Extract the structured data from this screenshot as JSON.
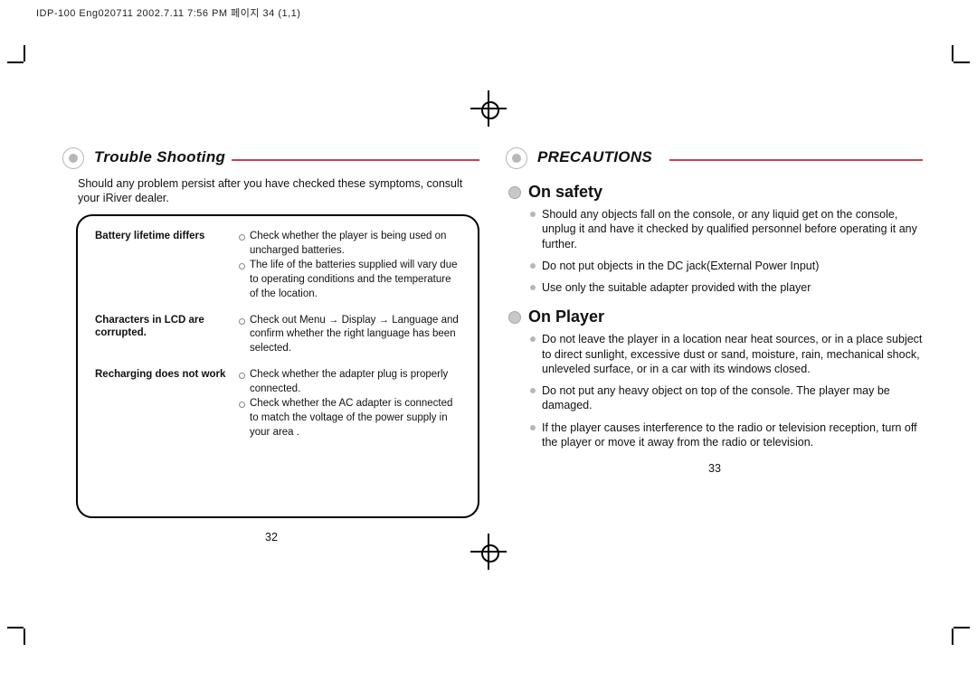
{
  "topstrip": "IDP-100 Eng020711  2002.7.11 7:56 PM  페이지 34 (1,1)",
  "left": {
    "title": "Trouble Shooting",
    "intro": "Should any problem persist after you have checked these symptoms, consult your iRiver dealer.",
    "rows": [
      {
        "label": "Battery lifetime differs",
        "items": [
          "Check whether the player is being used on uncharged batteries.",
          "The life of the batteries supplied will vary due to operating conditions and the temperature of the location."
        ]
      },
      {
        "label": "Characters in LCD are corrupted.",
        "items": [
          "Check out Menu → Display → Language and confirm whether the right language has been selected."
        ]
      },
      {
        "label": "Recharging does not work",
        "items": [
          "Check whether the adapter plug is properly connected.",
          "Check whether the AC adapter is connected to match the voltage of the power supply in your area ."
        ]
      }
    ],
    "pagenum": "32"
  },
  "right": {
    "title": "PRECAUTIONS",
    "sections": [
      {
        "heading": "On safety",
        "items": [
          "Should any objects fall on the console, or any liquid get on the console, unplug it and have it checked by qualified personnel before operating it any further.",
          "Do not put objects in the DC jack(External Power Input)",
          "Use only the suitable adapter provided with the player"
        ]
      },
      {
        "heading": "On Player",
        "items": [
          "Do not leave the player in a location near heat sources, or in a place subject to direct sunlight, excessive dust or sand, moisture, rain, mechanical shock, unleveled surface, or in a car with its windows closed.",
          "Do not put any heavy object on top of the console. The player may be damaged.",
          "If the player causes interference to the radio or television reception, turn off the player or move it away from the radio or television."
        ]
      }
    ],
    "pagenum": "33"
  }
}
